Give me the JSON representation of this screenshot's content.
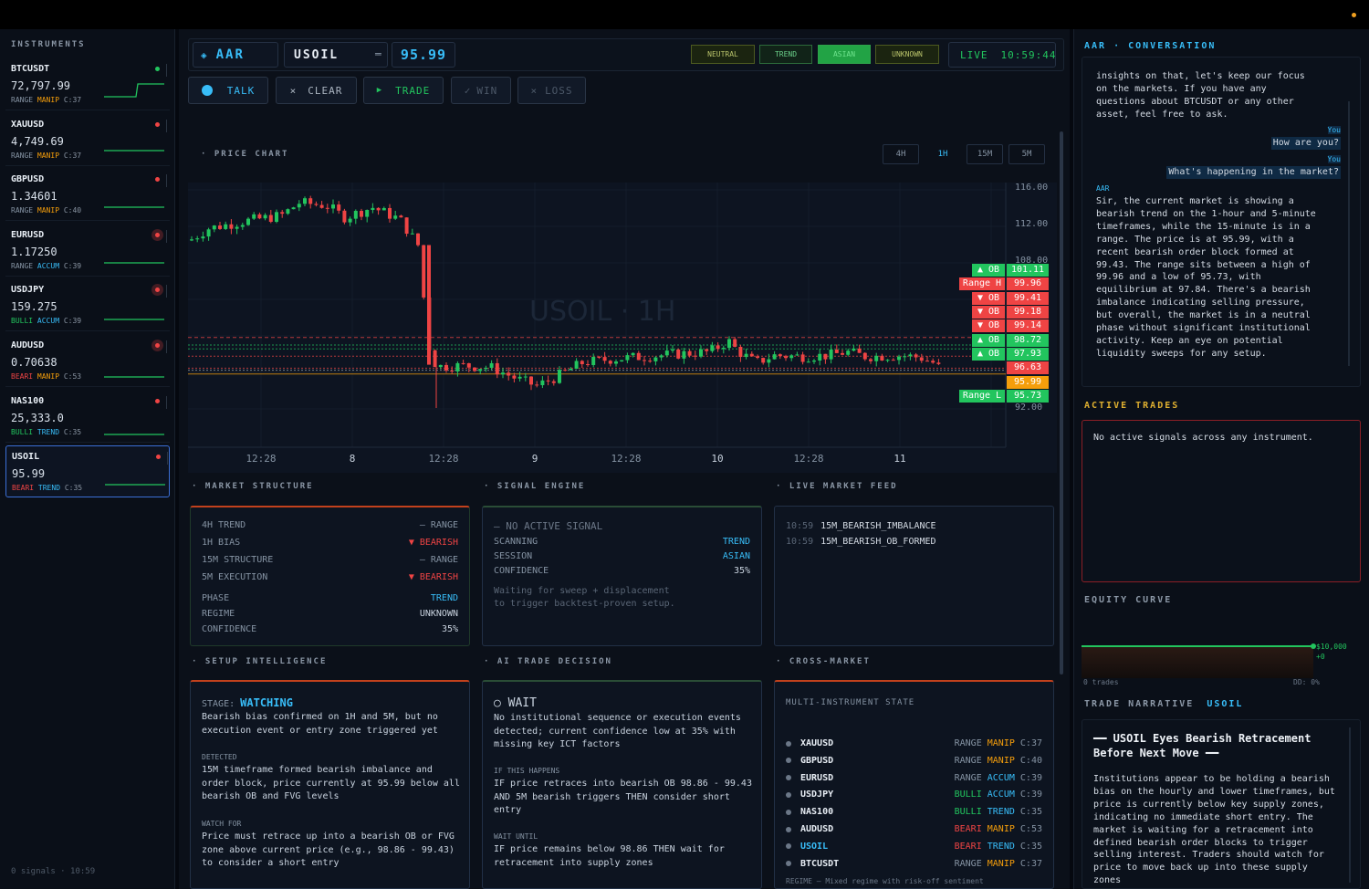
{
  "sidebar": {
    "title": "INSTRUMENTS",
    "footer": "0 signals  ·  10:59",
    "items": [
      {
        "symbol": "BTCUSDT",
        "price": "72,797.99",
        "tag1": "RANGE",
        "tag2": "MANIP",
        "conf": "C:37",
        "status_color": "#22c55e"
      },
      {
        "symbol": "XAUUSD",
        "price": "4,749.69",
        "tag1": "RANGE",
        "tag2": "MANIP",
        "conf": "C:37",
        "status_color": "#ef4444"
      },
      {
        "symbol": "GBPUSD",
        "price": "1.34601",
        "tag1": "RANGE",
        "tag2": "MANIP",
        "conf": "C:40",
        "status_color": "#ef4444"
      },
      {
        "symbol": "EURUSD",
        "price": "1.17250",
        "tag1": "RANGE",
        "tag2": "ACCUM",
        "conf": "C:39",
        "status_color": "#ef4444"
      },
      {
        "symbol": "USDJPY",
        "price": "159.275",
        "tag1": "BULLI",
        "tag2": "ACCUM",
        "conf": "C:39",
        "status_color": "#ef4444"
      },
      {
        "symbol": "AUDUSD",
        "price": "0.70638",
        "tag1": "BEARI",
        "tag2": "MANIP",
        "conf": "C:53",
        "status_color": "#ef4444"
      },
      {
        "symbol": "NAS100",
        "price": "25,333.0",
        "tag1": "BULLI",
        "tag2": "TREND",
        "conf": "C:35",
        "status_color": "#ef4444"
      },
      {
        "symbol": "USOIL",
        "price": "95.99",
        "tag1": "BEARI",
        "tag2": "TREND",
        "conf": "C:35",
        "status_color": "#ef4444"
      }
    ]
  },
  "header": {
    "app_name": "AAR",
    "symbol": "USOIL",
    "price": "95.99",
    "badges": [
      "NEUTRAL",
      "TREND",
      "ASIAN",
      "UNKNOWN"
    ],
    "live": "LIVE",
    "time": "10:59:44"
  },
  "actions": {
    "talk": "TALK",
    "clear": "CLEAR",
    "trade": "TRADE",
    "win": "WIN",
    "loss": "LOSS"
  },
  "chart": {
    "section": "PRICE CHART",
    "watermark": "USOIL · 1H",
    "timeframes": [
      "4H",
      "1H",
      "15M",
      "5M"
    ],
    "active_timeframe": "1H",
    "y_ticks": [
      "116.00",
      "112.00",
      "108.00",
      "92.00"
    ],
    "x_ticks": [
      "12:28",
      "8",
      "12:28",
      "9",
      "12:28",
      "10",
      "12:28",
      "11"
    ],
    "levels": [
      {
        "tag": "▲ OB",
        "price": "101.11",
        "tag_color": "#22c55e",
        "price_color": "#22c55e"
      },
      {
        "tag": "Range H",
        "price": "99.96",
        "tag_color": "#ef4444",
        "price_color": "#ef4444"
      },
      {
        "tag": "▼ OB",
        "price": "99.41",
        "tag_color": "#ef4444",
        "price_color": "#ef4444"
      },
      {
        "tag": "▼ OB",
        "price": "99.18",
        "tag_color": "#ef4444",
        "price_color": "#ef4444"
      },
      {
        "tag": "▼ OB",
        "price": "99.14",
        "tag_color": "#ef4444",
        "price_color": "#ef4444"
      },
      {
        "tag": "▲ OB",
        "price": "98.72",
        "tag_color": "#22c55e",
        "price_color": "#22c55e"
      },
      {
        "tag": "▲ OB",
        "price": "97.93",
        "tag_color": "#22c55e",
        "price_color": "#22c55e"
      },
      {
        "tag": "",
        "price": "96.63",
        "tag_color": "",
        "price_color": "#ef4444"
      },
      {
        "tag": "",
        "price": "95.99",
        "tag_color": "",
        "price_color": "#f59e0b"
      },
      {
        "tag": "Range L",
        "price": "95.73",
        "tag_color": "#22c55e",
        "price_color": "#22c55e"
      }
    ]
  },
  "market_structure": {
    "section": "MARKET STRUCTURE",
    "rows": [
      {
        "label": "4H TREND",
        "value": "— RANGE"
      },
      {
        "label": "1H BIAS",
        "value": "▼ BEARISH"
      },
      {
        "label": "15M STRUCTURE",
        "value": "— RANGE"
      },
      {
        "label": "5M EXECUTION",
        "value": "▼ BEARISH"
      },
      {
        "label": "PHASE",
        "value": "TREND"
      },
      {
        "label": "REGIME",
        "value": "UNKNOWN"
      },
      {
        "label": "CONFIDENCE",
        "value": "35%"
      }
    ]
  },
  "signal_engine": {
    "section": "SIGNAL ENGINE",
    "status": "— NO ACTIVE SIGNAL",
    "rows": [
      {
        "label": "SCANNING",
        "value": "TREND"
      },
      {
        "label": "SESSION",
        "value": "ASIAN"
      },
      {
        "label": "CONFIDENCE",
        "value": "35%"
      }
    ],
    "note1": "Waiting for sweep + displacement",
    "note2": "to trigger backtest-proven setup."
  },
  "live_feed": {
    "section": "LIVE MARKET FEED",
    "items": [
      {
        "time": "10:59",
        "text": "15M_BEARISH_IMBALANCE"
      },
      {
        "time": "10:59",
        "text": "15M_BEARISH_OB_FORMED"
      }
    ]
  },
  "setup": {
    "section": "SETUP INTELLIGENCE",
    "stage_label": "STAGE:",
    "stage": "WATCHING",
    "summary": "Bearish bias confirmed on 1H and 5M, but no execution event or entry zone triggered yet",
    "detected_label": "DETECTED",
    "detected": "15M timeframe formed bearish imbalance and order block, price currently at 95.99 below all bearish OB and FVG levels",
    "watch_label": "WATCH FOR",
    "watch": "Price must retrace up into a bearish OB or FVG zone above current price (e.g., 98.86 - 99.43) to consider a short entry"
  },
  "ai_decision": {
    "section": "AI TRADE DECISION",
    "decision": "○ WAIT",
    "summary": "No institutional sequence or execution events detected; current confidence low at 35% with missing key ICT factors",
    "if_label": "IF THIS HAPPENS",
    "if_text": "IF price retraces into bearish OB 98.86 - 99.43 AND 5M bearish triggers THEN consider short entry",
    "wait_label": "WAIT UNTIL",
    "wait_text": "IF price remains below 98.86 THEN wait for retracement into supply zones"
  },
  "cross_market": {
    "section": "CROSS-MARKET",
    "title": "MULTI-INSTRUMENT STATE",
    "rows": [
      {
        "symbol": "XAUUSD",
        "a": "RANGE",
        "b": "MANIP",
        "c": "C:37"
      },
      {
        "symbol": "GBPUSD",
        "a": "RANGE",
        "b": "MANIP",
        "c": "C:40"
      },
      {
        "symbol": "EURUSD",
        "a": "RANGE",
        "b": "ACCUM",
        "c": "C:39"
      },
      {
        "symbol": "USDJPY",
        "a": "BULLI",
        "b": "ACCUM",
        "c": "C:39"
      },
      {
        "symbol": "NAS100",
        "a": "BULLI",
        "b": "TREND",
        "c": "C:35"
      },
      {
        "symbol": "AUDUSD",
        "a": "BEARI",
        "b": "MANIP",
        "c": "C:53"
      },
      {
        "symbol": "USOIL",
        "a": "BEARI",
        "b": "TREND",
        "c": "C:35"
      },
      {
        "symbol": "BTCUSDT",
        "a": "RANGE",
        "b": "MANIP",
        "c": "C:37"
      }
    ],
    "footer": "REGIME — Mixed regime with risk-off sentiment"
  },
  "conversation": {
    "section": "AAR · CONVERSATION",
    "msg1": "insights on that, let's keep our focus on the markets. If you have any questions about BTCUSDT or any other asset, feel free to ask.",
    "you_label": "You",
    "q1": "How are you?",
    "q2": "What's happening in the market?",
    "aar_label": "AAR",
    "reply": "Sir, the current market is showing a bearish trend on the 1-hour and 5-minute timeframes, while the 15-minute is in a range. The price is at 95.99, with a recent bearish order block formed at 99.43. The range sits between a high of 99.96 and a low of 95.73, with equilibrium at 97.84. There's a bearish imbalance indicating selling pressure, but overall, the market is in a neutral phase without significant institutional activity. Keep an eye on potential liquidity sweeps for any setup."
  },
  "active_trades": {
    "section": "ACTIVE TRADES",
    "empty": "No active signals across any instrument."
  },
  "equity": {
    "section": "EQUITY CURVE",
    "value": "$10,000",
    "delta": "+0",
    "trades": "0 trades",
    "dd": "DD: 0%"
  },
  "narrative": {
    "section": "TRADE NARRATIVE",
    "symbol": "USOIL",
    "title": "━━ USOIL Eyes Bearish Retracement Before Next Move ━━",
    "body": "Institutions appear to be holding a bearish bias on the hourly and lower timeframes, but price is currently below key supply zones, indicating no immediate short entry. The market is waiting for a retracement into defined bearish order blocks to trigger selling interest. Traders should watch for price to move back up into these supply zones"
  }
}
